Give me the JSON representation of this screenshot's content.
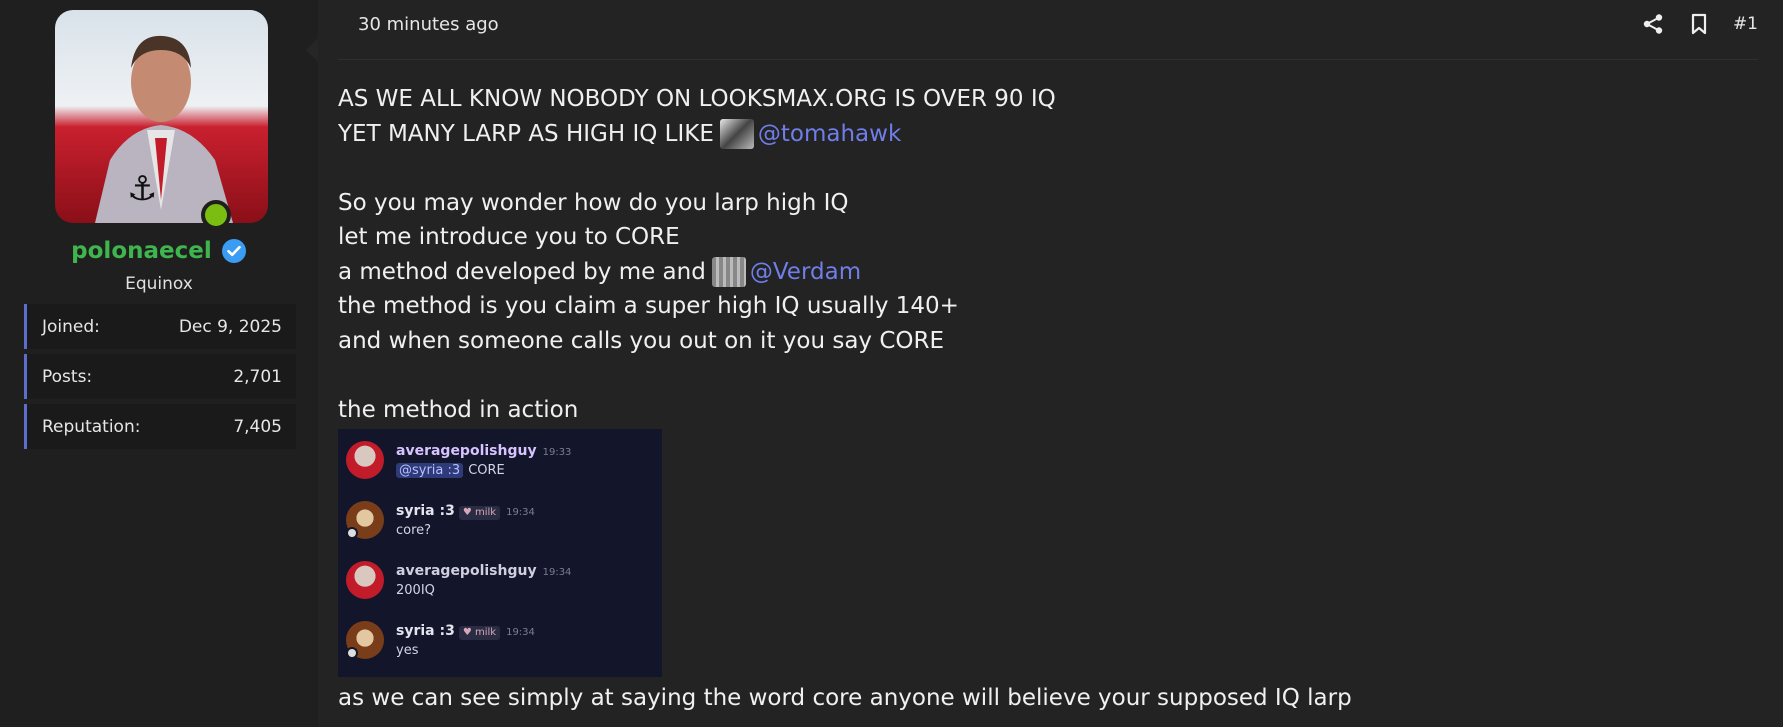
{
  "user": {
    "name": "polonaecel",
    "title": "Equinox",
    "stats": [
      {
        "label": "Joined:",
        "value": "Dec 9, 2025"
      },
      {
        "label": "Posts:",
        "value": "2,701"
      },
      {
        "label": "Reputation:",
        "value": "7,405"
      }
    ]
  },
  "post": {
    "time": "30 minutes ago",
    "number": "#1",
    "lines": {
      "l1": "AS WE ALL KNOW NOBODY ON LOOKSMAX.ORG IS OVER 90 IQ",
      "l2": "YET MANY LARP AS HIGH IQ LIKE",
      "mention1": "@tomahawk",
      "l3": "So you may wonder how do you larp high IQ",
      "l4": "let me introduce you to CORE",
      "l5": "a method developed by me and",
      "mention2": "@Verdam",
      "l6": "the method is you claim a super high IQ usually 140+",
      "l7": "and when someone calls you out on it you say CORE",
      "l8": "the method in action",
      "l9": "as we can see simply at saying the word core anyone will believe your supposed IQ larp"
    }
  },
  "chat": [
    {
      "name": "averagepolishguy",
      "time": "19:33",
      "ping": "@syria :3",
      "text": "CORE",
      "tag": ""
    },
    {
      "name": "syria :3",
      "time": "19:34",
      "ping": "",
      "text": "core?",
      "tag": "milk"
    },
    {
      "name": "averagepolishguy",
      "time": "19:34",
      "ping": "",
      "text": "200IQ",
      "tag": ""
    },
    {
      "name": "syria :3",
      "time": "19:34",
      "ping": "",
      "text": "yes",
      "tag": "milk"
    }
  ],
  "colors": {
    "username": "#3fb54e",
    "mention": "#6f7ee8",
    "online": "#7cbd12",
    "stat_accent": "#5c6dcc"
  },
  "icons": [
    "share-icon",
    "bookmark-icon",
    "verified-icon"
  ]
}
